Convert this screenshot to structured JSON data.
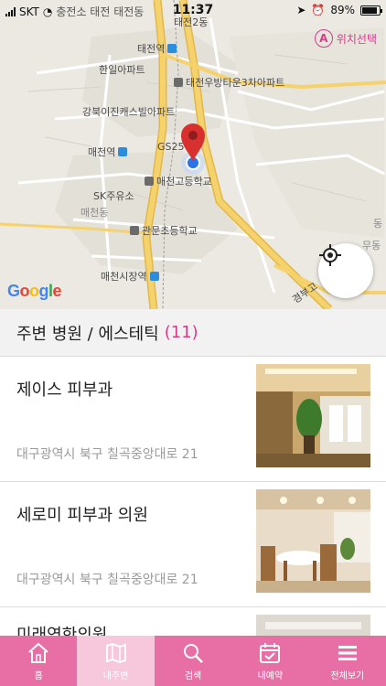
{
  "status_bar": {
    "carrier": "SKT",
    "extra": "충전소 태전 태전동",
    "time": "11:37",
    "battery": "89%",
    "battery_level": 0.89
  },
  "map": {
    "location_select_label": "위치선택",
    "location_select_icon_letter": "A",
    "labels": {
      "taejeon2dong": "태전2동",
      "taejeon_station": "태전역",
      "hanil_apt": "한일아파트",
      "taejeon_woobang": "태전우방타운3차아파트",
      "gangbuk_ijin": "강북이진캐스빌아파트",
      "maecheon_station": "매천역",
      "gs25": "GS25",
      "maecheon_highschool": "매천고등학교",
      "sk_gas": "SK주유소",
      "maecheon_dong": "매천동",
      "gwanmun_elementary": "관문초등학교",
      "maecheon_market_station": "매천시장역",
      "edge_dong": "동",
      "edge_dong2": "무동",
      "gyeongbu": "경부고"
    },
    "attribution": [
      "G",
      "o",
      "o",
      "g",
      "l",
      "e"
    ]
  },
  "section": {
    "title": "주변 병원 / 에스테틱",
    "count": "(11)"
  },
  "clinics": [
    {
      "name": "제이스 피부과",
      "address": "대구광역시 북구 칠곡중앙대로 21"
    },
    {
      "name": "세로미 피부과 의원",
      "address": "대구광역시 북구 칠곡중앙대로 21"
    },
    {
      "name": "미래연한의원",
      "address": ""
    }
  ],
  "nav": [
    {
      "label": "홈",
      "icon": "home-icon",
      "active": false
    },
    {
      "label": "내주변",
      "icon": "map-icon",
      "active": true
    },
    {
      "label": "검색",
      "icon": "search-icon",
      "active": false
    },
    {
      "label": "내예약",
      "icon": "calendar-check-icon",
      "active": false
    },
    {
      "label": "전체보기",
      "icon": "menu-icon",
      "active": false
    }
  ],
  "colors": {
    "accent": "#d93a8c",
    "nav_bg": "#e86fa6",
    "nav_active_bg": "#f7c7dc",
    "map_bg": "#ece9e2",
    "road_yellow": "#f5d26b",
    "pin_red": "#d8302f",
    "location_blue": "#2a73e8"
  }
}
